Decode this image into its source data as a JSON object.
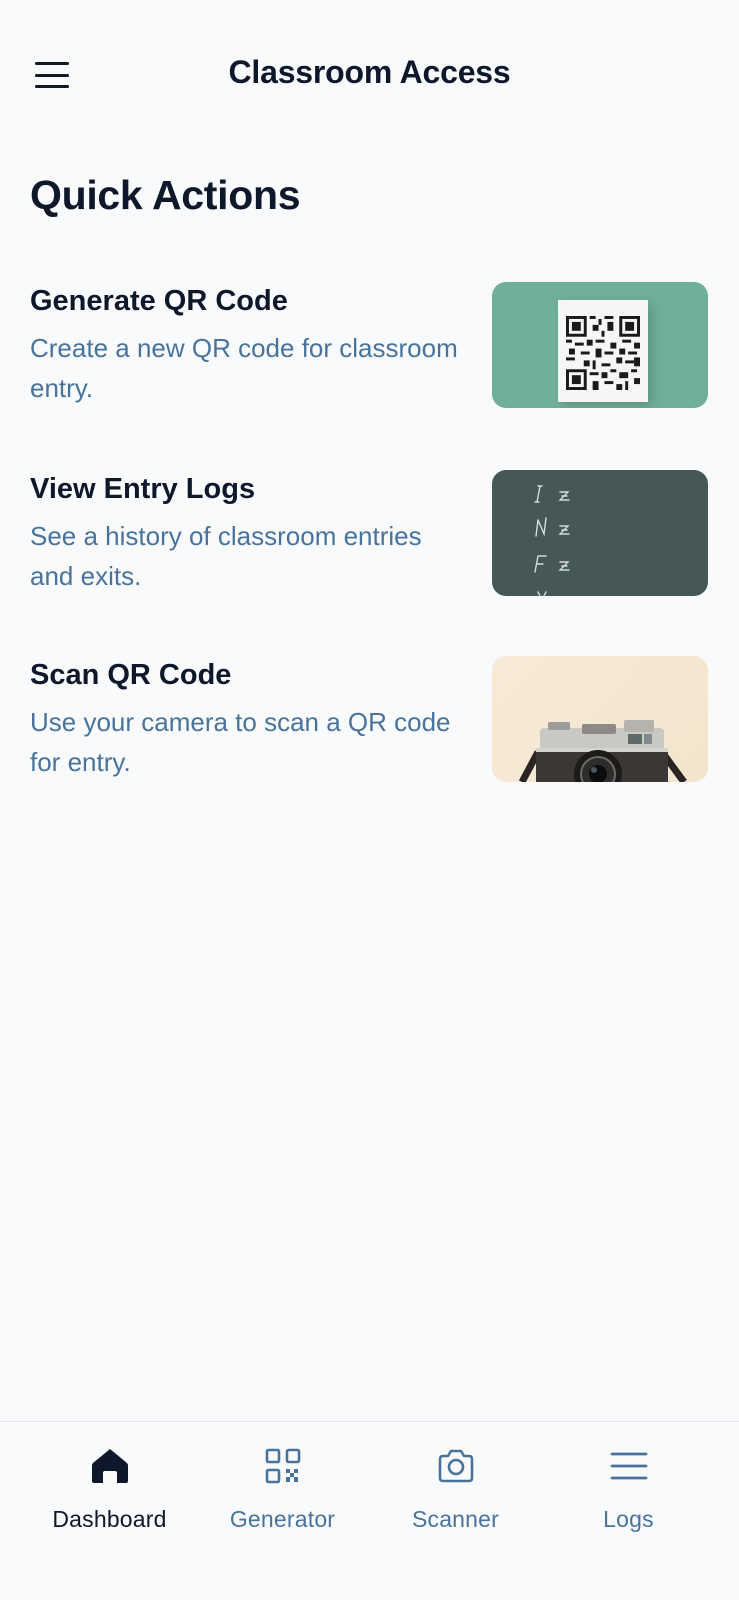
{
  "header": {
    "title": "Classroom Access",
    "menu_icon": "hamburger-menu-icon"
  },
  "quick_actions": {
    "title": "Quick Actions",
    "items": [
      {
        "title": "Generate QR Code",
        "description": "Create a new QR code for classroom entry.",
        "thumbnail": "qr-code-paper-image",
        "thumb_color": "#70b09b"
      },
      {
        "title": "View Entry Logs",
        "description": "See a history of classroom entries and exits.",
        "thumbnail": "chalkboard-logs-image",
        "thumb_color": "#455756"
      },
      {
        "title": "Scan QR Code",
        "description": "Use your camera to scan a QR code for entry.",
        "thumbnail": "vintage-camera-image",
        "thumb_color": "#f5e7d2"
      }
    ]
  },
  "bottom_nav": {
    "items": [
      {
        "label": "Dashboard",
        "icon": "home-icon",
        "active": true
      },
      {
        "label": "Generator",
        "icon": "qr-code-icon",
        "active": false
      },
      {
        "label": "Scanner",
        "icon": "camera-icon",
        "active": false
      },
      {
        "label": "Logs",
        "icon": "list-icon",
        "active": false
      }
    ]
  },
  "colors": {
    "background": "#f8fafc",
    "text_primary": "#0f172a",
    "text_secondary": "#4a739c",
    "divider": "#e5e7eb"
  }
}
